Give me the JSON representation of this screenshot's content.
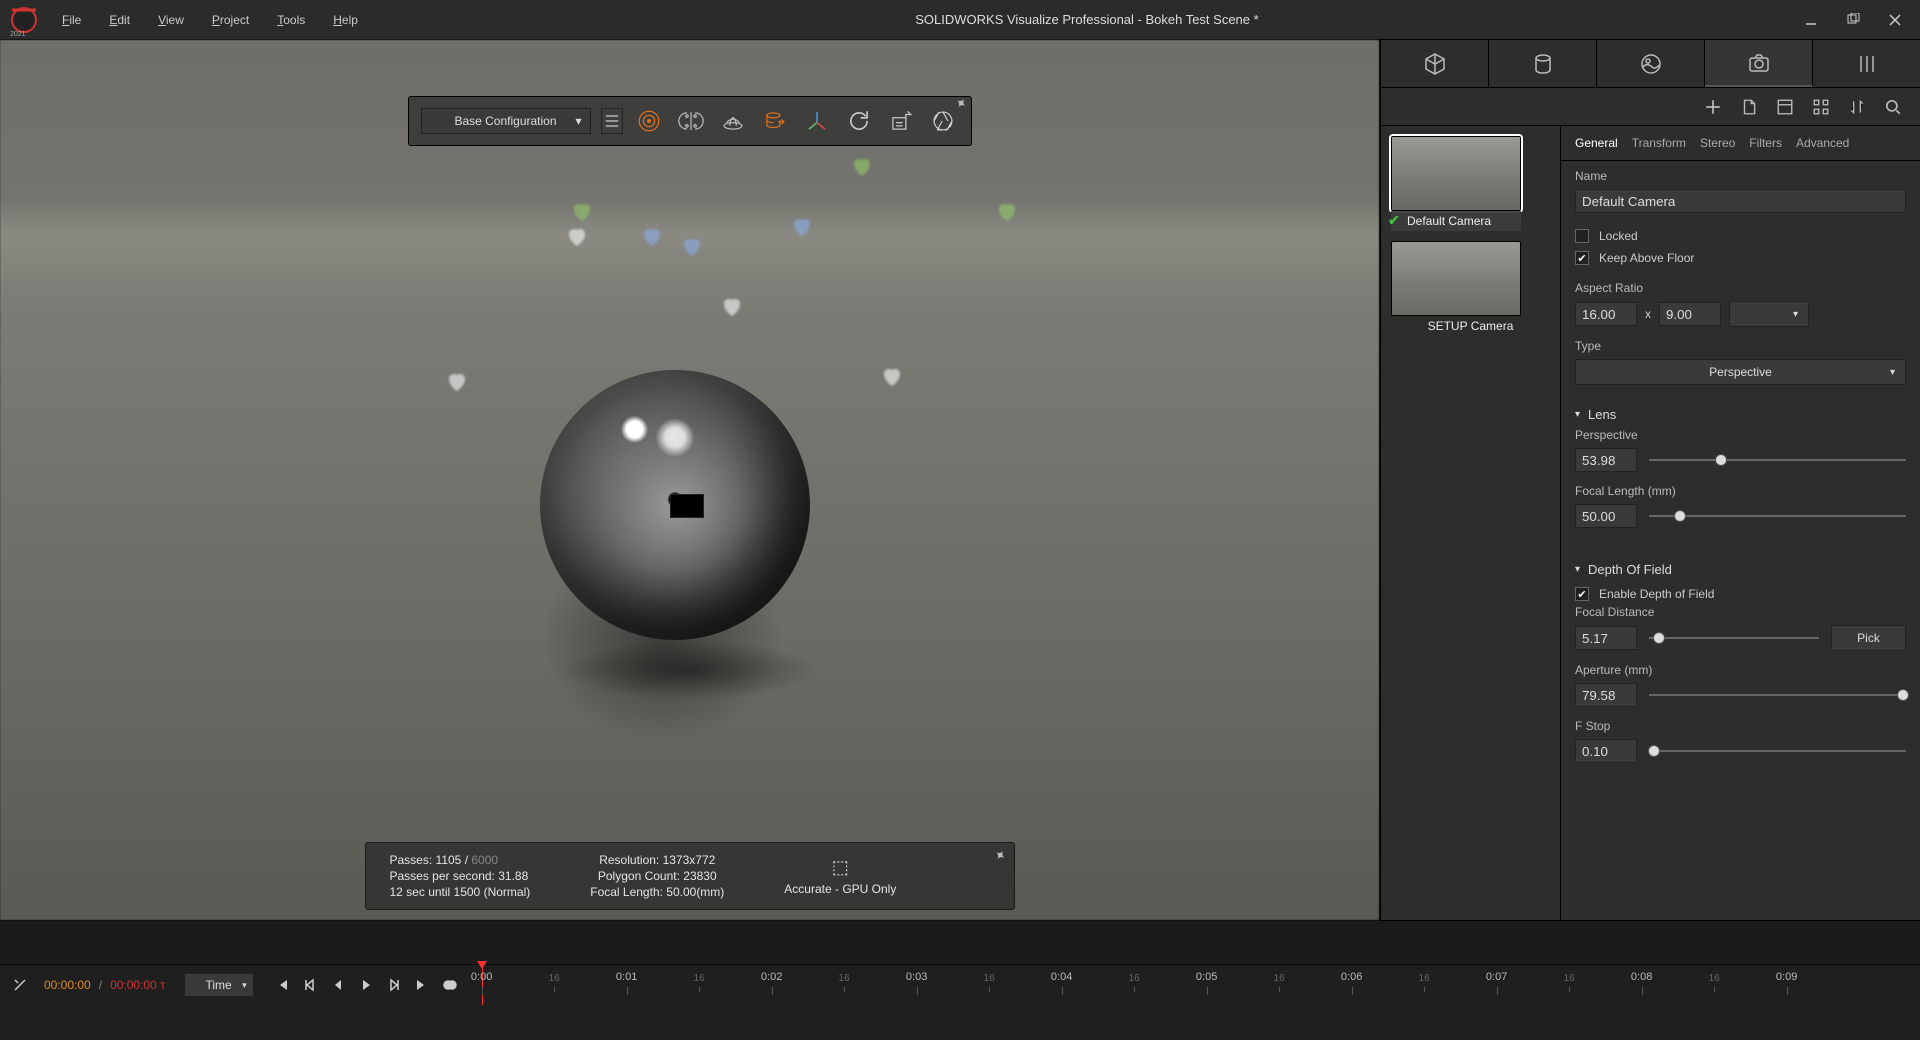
{
  "title": "SOLIDWORKS Visualize Professional - Bokeh Test Scene *",
  "logo_year": "2021",
  "menus": {
    "file": "File",
    "edit": "Edit",
    "view": "View",
    "project": "Project",
    "tools": "Tools",
    "help": "Help"
  },
  "float": {
    "config": "Base Configuration"
  },
  "status": {
    "passes_label": "Passes:",
    "passes_cur": "1105",
    "passes_sep": "/",
    "passes_max": "6000",
    "pps": "Passes per second: 31.88",
    "eta": "12 sec until 1500 (Normal)",
    "res": "Resolution: 1373x772",
    "poly": "Polygon Count: 23830",
    "flen": "Focal Length: 50.00(mm)",
    "mode": "Accurate - GPU Only"
  },
  "cams": {
    "default": "Default Camera",
    "setup": "SETUP Camera"
  },
  "props": {
    "tabs": {
      "general": "General",
      "transform": "Transform",
      "stereo": "Stereo",
      "filters": "Filters",
      "advanced": "Advanced"
    },
    "name_lbl": "Name",
    "name_val": "Default Camera",
    "locked": "Locked",
    "keep_above": "Keep Above Floor",
    "aspect_lbl": "Aspect Ratio",
    "aspect_w": "16.00",
    "aspect_x": "x",
    "aspect_h": "9.00",
    "type_lbl": "Type",
    "type_val": "Perspective",
    "lens_hdr": "Lens",
    "persp_lbl": "Perspective",
    "persp_val": "53.98",
    "flen_lbl": "Focal Length (mm)",
    "flen_val": "50.00",
    "dof_hdr": "Depth Of Field",
    "dof_enable": "Enable Depth of Field",
    "fdist_lbl": "Focal Distance",
    "fdist_val": "5.17",
    "pick": "Pick",
    "aperture_lbl": "Aperture (mm)",
    "aperture_val": "79.58",
    "fstop_lbl": "F Stop",
    "fstop_val": "0.10"
  },
  "timeline": {
    "cur": "00:00:00",
    "sep": " / ",
    "total": "00:00:00 т",
    "mode": "Time",
    "ticks": [
      "0:00",
      "0:01",
      "0:02",
      "0:03",
      "0:04",
      "0:05",
      "0:06",
      "0:07",
      "0:08",
      "0:09"
    ]
  }
}
